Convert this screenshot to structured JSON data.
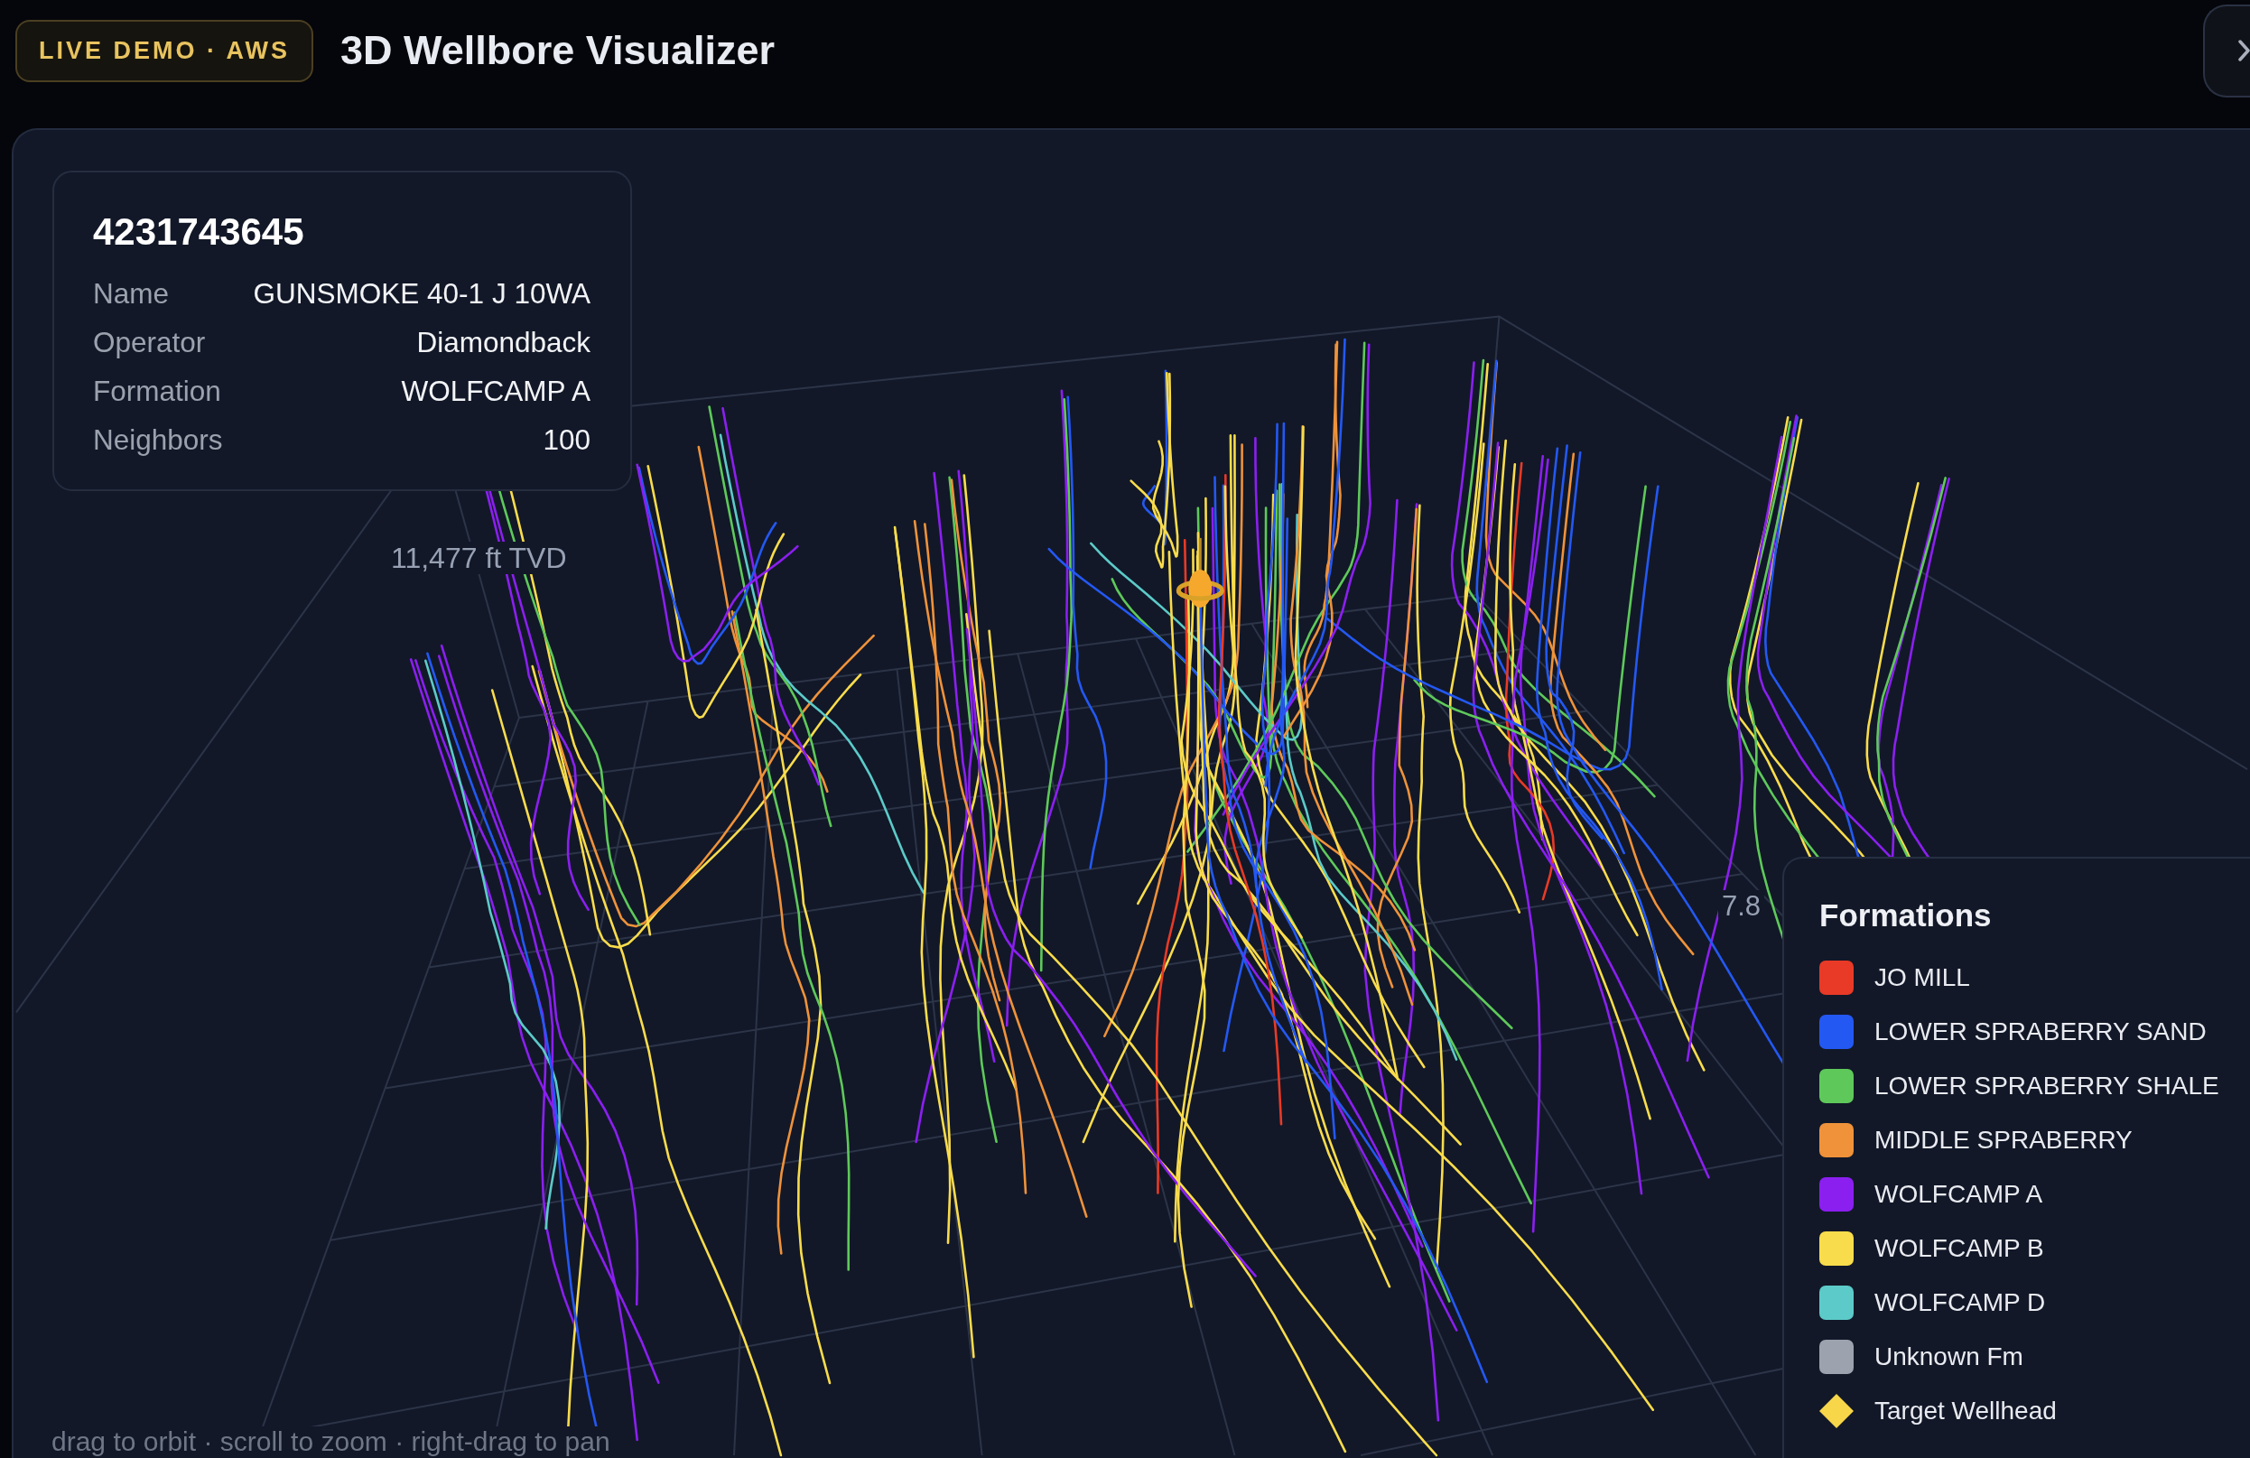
{
  "header": {
    "badge": "LIVE DEMO · AWS",
    "title": "3D Wellbore Visualizer"
  },
  "well_card": {
    "api_number": "4231743645",
    "rows": [
      {
        "label": "Name",
        "value": "GUNSMOKE 40-1 J 10WA"
      },
      {
        "label": "Operator",
        "value": "Diamondback"
      },
      {
        "label": "Formation",
        "value": "WOLFCAMP A"
      },
      {
        "label": "Neighbors",
        "value": "100"
      }
    ]
  },
  "scene": {
    "depth_label": "11,477 ft TVD",
    "axis_value": "7.8",
    "hint": "drag to orbit · scroll to zoom · right-drag to pan"
  },
  "legend": {
    "title": "Formations",
    "items": [
      {
        "kind": "swatch",
        "label": "JO MILL",
        "color": "#e83a26"
      },
      {
        "kind": "swatch",
        "label": "LOWER SPRABERRY SAND",
        "color": "#2458f2"
      },
      {
        "kind": "swatch",
        "label": "LOWER SPRABERRY SHALE",
        "color": "#5ec95a"
      },
      {
        "kind": "swatch",
        "label": "MIDDLE SPRABERRY",
        "color": "#ef923a"
      },
      {
        "kind": "swatch",
        "label": "WOLFCAMP A",
        "color": "#8b1ff0"
      },
      {
        "kind": "swatch",
        "label": "WOLFCAMP B",
        "color": "#f9dc4c"
      },
      {
        "kind": "swatch",
        "label": "WOLFCAMP D",
        "color": "#5ccac8"
      },
      {
        "kind": "swatch",
        "label": "Unknown Fm",
        "color": "#9ca3af"
      },
      {
        "kind": "diamond",
        "label": "Target Wellhead",
        "color": "#f8d64a"
      }
    ]
  }
}
